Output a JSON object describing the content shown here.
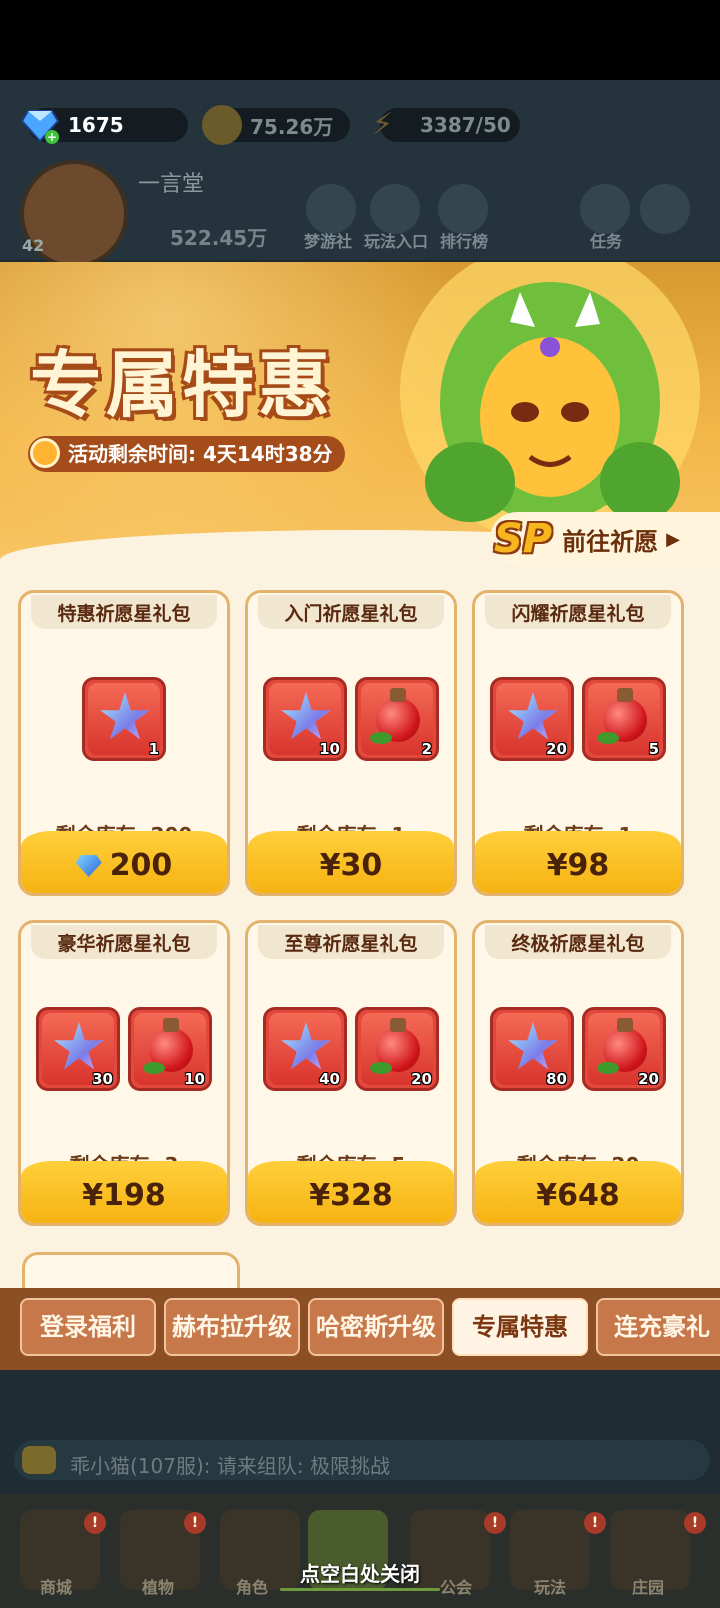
{
  "resources": {
    "gems": "1675",
    "gold": "75.26万",
    "energy": "3387/50"
  },
  "profile": {
    "name": "一言堂",
    "level": "42",
    "power": "522.45万"
  },
  "top_icons": [
    "梦游社",
    "玩法入口",
    "排行榜",
    "",
    "任务"
  ],
  "banner": {
    "title": "专属特惠",
    "timer": "活动剩余时间: 4天14时38分",
    "wish_button": "前往祈愿",
    "sp_badge": "SP"
  },
  "packs": [
    {
      "title": "特惠祈愿星礼包",
      "items": [
        {
          "type": "star",
          "qty": "1"
        }
      ],
      "stock": "剩余库存: 200",
      "price": "200",
      "currency": "gem"
    },
    {
      "title": "入门祈愿星礼包",
      "items": [
        {
          "type": "star",
          "qty": "10"
        },
        {
          "type": "potion",
          "qty": "2"
        }
      ],
      "stock": "剩余库存: 1",
      "price": "¥30",
      "currency": "cny"
    },
    {
      "title": "闪耀祈愿星礼包",
      "items": [
        {
          "type": "star",
          "qty": "20"
        },
        {
          "type": "potion",
          "qty": "5"
        }
      ],
      "stock": "剩余库存: 1",
      "price": "¥98",
      "currency": "cny"
    },
    {
      "title": "豪华祈愿星礼包",
      "items": [
        {
          "type": "star",
          "qty": "30"
        },
        {
          "type": "potion",
          "qty": "10"
        }
      ],
      "stock": "剩余库存: 3",
      "price": "¥198",
      "currency": "cny"
    },
    {
      "title": "至尊祈愿星礼包",
      "items": [
        {
          "type": "star",
          "qty": "40"
        },
        {
          "type": "potion",
          "qty": "20"
        }
      ],
      "stock": "剩余库存: 5",
      "price": "¥328",
      "currency": "cny"
    },
    {
      "title": "终极祈愿星礼包",
      "items": [
        {
          "type": "star",
          "qty": "80"
        },
        {
          "type": "potion",
          "qty": "20"
        }
      ],
      "stock": "剩余库存: 20",
      "price": "¥648",
      "currency": "cny"
    }
  ],
  "tabs": [
    {
      "label": "登录福利",
      "active": false
    },
    {
      "label": "赫布拉升级",
      "active": false
    },
    {
      "label": "哈密斯升级",
      "active": false
    },
    {
      "label": "专属特惠",
      "active": true
    },
    {
      "label": "连充豪礼",
      "active": false
    }
  ],
  "chat": {
    "text": "乖小猫(107服): 请来组队: 极限挑战"
  },
  "bottom_nav": [
    "商城",
    "植物",
    "角色",
    "",
    "公会",
    "玩法",
    "庄园"
  ],
  "close_hint": "点空白处关闭",
  "colors": {
    "accent": "#f6b312",
    "tab_bg": "#c7784a",
    "card_border": "#e3b36e",
    "item_bg": "#e2483c"
  }
}
